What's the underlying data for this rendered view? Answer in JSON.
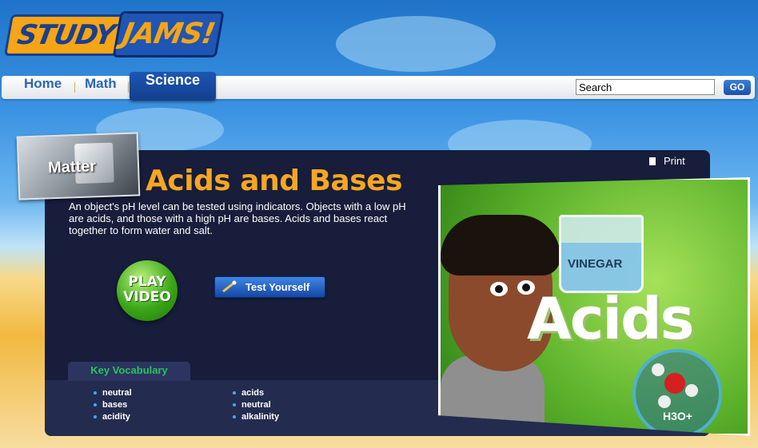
{
  "logo": {
    "part1": "STUDY",
    "part2": "JAMS!"
  },
  "nav": {
    "items": [
      "Home",
      "Math",
      "Science"
    ],
    "active": "Science"
  },
  "search": {
    "value": "Search",
    "button_label": "GO"
  },
  "topic": {
    "category_label": "Matter"
  },
  "print_label": "Print",
  "page": {
    "title": "Acids and Bases",
    "description": "An object's pH level can be tested using indicators. Objects with a low pH are acids, and those with a high pH are bases. Acids and bases react together to form water and salt."
  },
  "play_video": {
    "line1": "PLAY",
    "line2": "VIDEO"
  },
  "test_yourself_label": "Test Yourself",
  "vocabulary": {
    "heading": "Key Vocabulary",
    "column1": [
      "neutral",
      "bases",
      "acidity"
    ],
    "column2": [
      "acids",
      "neutral",
      "alkalinity"
    ]
  },
  "feature_image": {
    "beaker_label": "VINEGAR",
    "headline": "Acids",
    "formula": "H3O+"
  },
  "colors": {
    "title": "#f5a623",
    "panel": "#171d3a",
    "vocab_heading": "#27c35e",
    "nav_link": "#2a66b8"
  },
  "icons": [
    "document-icon",
    "magic-wand-icon",
    "play-icon"
  ]
}
